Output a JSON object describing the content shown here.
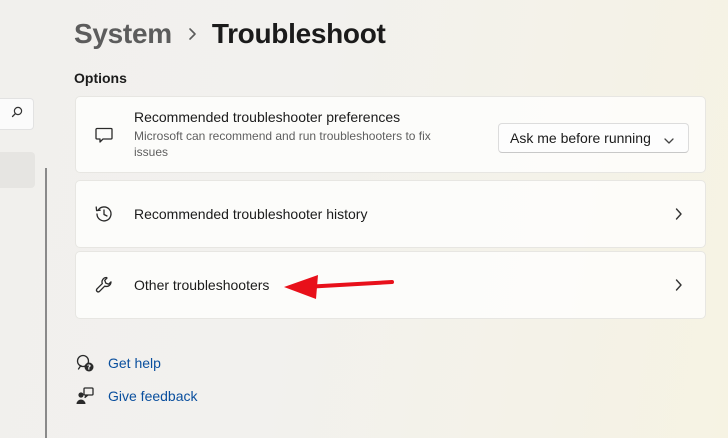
{
  "breadcrumb": {
    "parent": "System",
    "separator_icon": "chevron-right",
    "current": "Troubleshoot"
  },
  "sidebar": {
    "search_icon": "search-icon"
  },
  "options": {
    "section_title": "Options",
    "items": [
      {
        "title": "Recommended troubleshooter preferences",
        "description": "Microsoft can recommend and run troubleshooters to fix issues",
        "icon": "comment-icon",
        "dropdown_value": "Ask me before running"
      },
      {
        "title": "Recommended troubleshooter history",
        "icon": "history-icon"
      },
      {
        "title": "Other troubleshooters",
        "icon": "wrench-icon"
      }
    ]
  },
  "links": {
    "help": "Get help",
    "feedback": "Give feedback"
  },
  "annotation": {
    "arrow_color": "#e8101a"
  },
  "colors": {
    "link": "#0a4f9e",
    "accent_arrow": "#e8101a"
  }
}
